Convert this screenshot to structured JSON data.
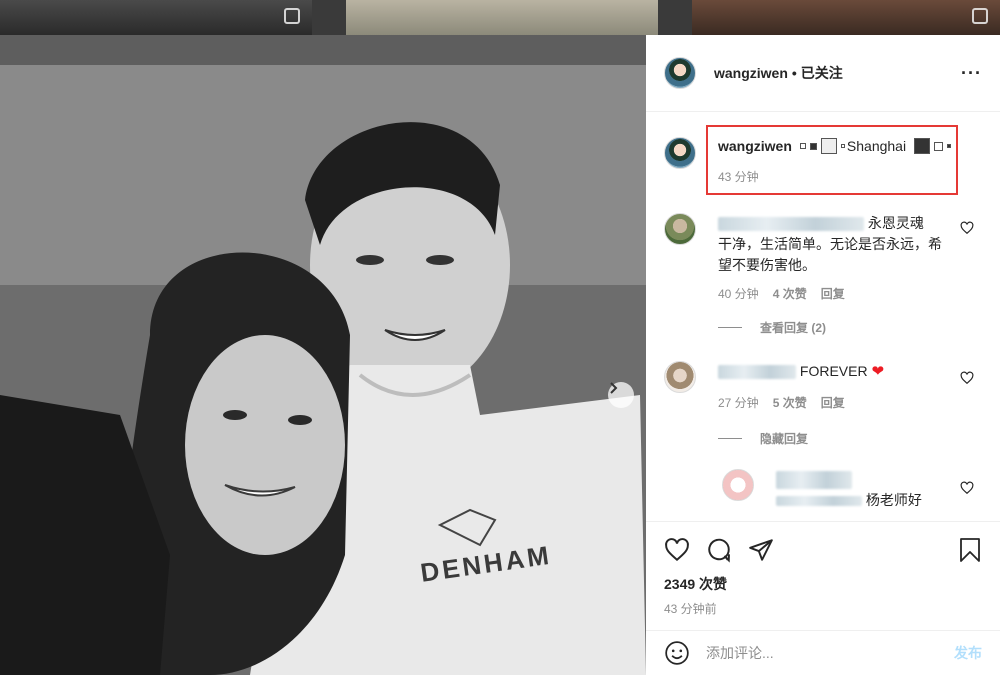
{
  "post": {
    "username": "wangziwen",
    "follow_status": " • 已关注",
    "more_icon": "more-horizontal-icon",
    "caption": {
      "username": "wangziwen",
      "location_text": "Shanghai",
      "time": "43 分钟"
    },
    "comments": [
      {
        "suffix_text": "永恩灵魂",
        "text_rest": "干净，生活简单。无论是否永远，希望不要伤害他。",
        "time": "40 分钟",
        "likes": "4 次赞",
        "reply": "回复",
        "view_replies": "查看回复 (2)"
      },
      {
        "text": "FOREVER",
        "time": "27 分钟",
        "likes": "5 次赞",
        "reply": "回复",
        "hide_replies": "隐藏回复"
      },
      {
        "text": "杨老师好"
      }
    ],
    "likes": "2349 次赞",
    "posted": "43 分钟前",
    "add_comment_placeholder": "添加评论...",
    "post_button": "发布"
  },
  "photo": {
    "shirt_text": "DENHAM",
    "carousel_dots": 4,
    "active_dot": 0
  },
  "colors": {
    "highlight": "#e53935",
    "link_blue": "#3897f0",
    "muted": "#8e8e8e"
  }
}
